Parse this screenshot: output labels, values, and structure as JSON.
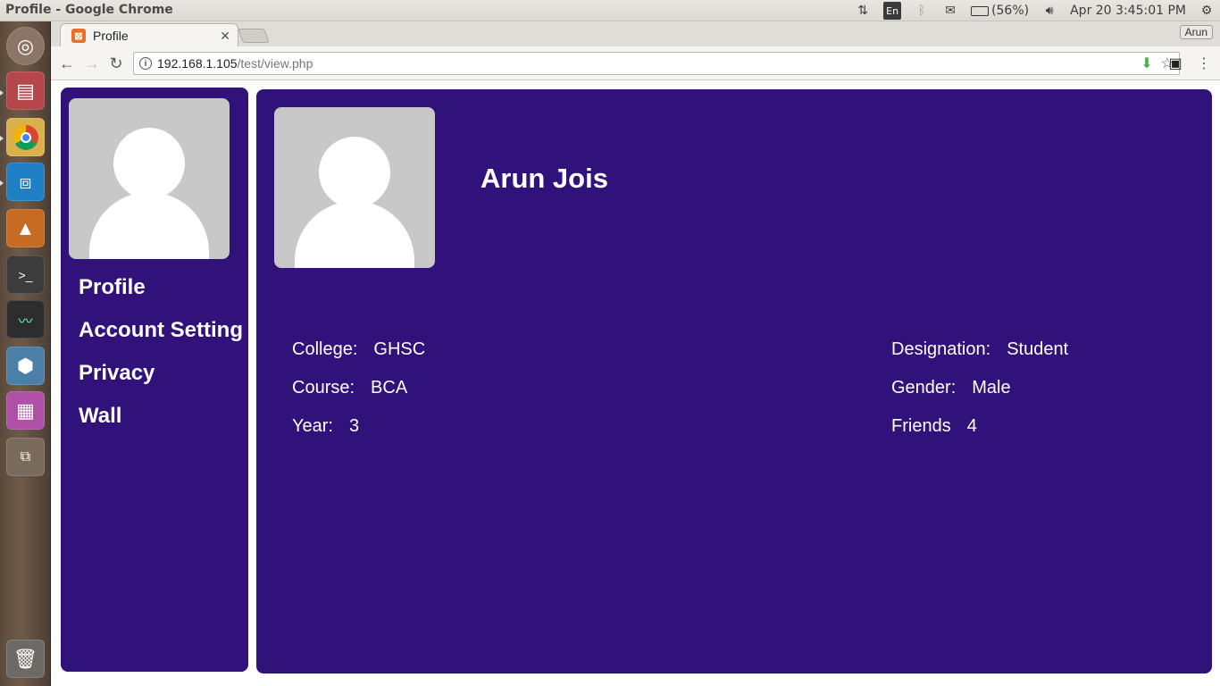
{
  "os": {
    "window_title": "Profile - Google Chrome",
    "tray": {
      "lang": "En",
      "battery": "(56%)",
      "datetime": "Apr 20  3:45:01 PM"
    }
  },
  "browser": {
    "tab_title": "Profile",
    "url_host": "192.168.1.105",
    "url_path": "/test/view.php",
    "profile_name": "Arun"
  },
  "sidebar": {
    "items": [
      {
        "label": "Profile"
      },
      {
        "label": "Account Setting"
      },
      {
        "label": "Privacy"
      },
      {
        "label": "Wall"
      }
    ]
  },
  "profile": {
    "name": "Arun Jois",
    "left": [
      {
        "label": "College:",
        "value": "GHSC"
      },
      {
        "label": "Course:",
        "value": "BCA"
      },
      {
        "label": "Year:",
        "value": "3"
      }
    ],
    "right": [
      {
        "label": "Designation:",
        "value": "Student"
      },
      {
        "label": "Gender:",
        "value": "Male"
      },
      {
        "label": "Friends",
        "value": "4"
      }
    ]
  },
  "colors": {
    "panel_purple": "#31117a",
    "avatar_gray": "#c8c8c8"
  }
}
